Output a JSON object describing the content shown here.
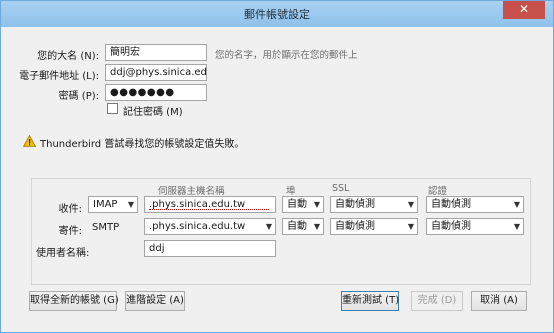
{
  "window": {
    "title": "郵件帳號設定",
    "close_glyph": "✕"
  },
  "identity": {
    "name_label": "您的大名 (N):",
    "name_value": "簡明宏",
    "name_hint": "您的名字，用於顯示在您的郵件上",
    "email_label": "電子郵件地址 (L):",
    "email_value": "ddj@phys.sinica.edu.tw",
    "password_label": "密碼 (P):",
    "password_value": "●●●●●●●",
    "remember_label": "記住密碼 (M)",
    "remember_checked": false
  },
  "status": {
    "icon": "warning-icon",
    "message": "Thunderbird 嘗試尋找您的帳號設定值失敗。"
  },
  "server": {
    "headers": {
      "hostname": "伺服器主機名稱",
      "port": "埠",
      "ssl": "SSL",
      "auth": "認證"
    },
    "incoming": {
      "label": "收件:",
      "protocol": "IMAP",
      "hostname": ".phys.sinica.edu.tw",
      "port": "自動",
      "ssl": "自動偵測",
      "auth": "自動偵測"
    },
    "outgoing": {
      "label": "寄件:",
      "protocol": "SMTP",
      "hostname": ".phys.sinica.edu.tw",
      "port": "自動",
      "ssl": "自動偵測",
      "auth": "自動偵測"
    },
    "username_label": "使用者名稱:",
    "username_value": "ddj"
  },
  "buttons": {
    "new_account": "取得全新的帳號 (G)",
    "advanced": "進階設定 (A)",
    "retest": "重新測試 (T)",
    "done": "完成 (D)",
    "cancel": "取消 (A)"
  },
  "colors": {
    "titlebar": "#9ccbef",
    "close": "#c7504a",
    "warning": "#f2c200"
  }
}
